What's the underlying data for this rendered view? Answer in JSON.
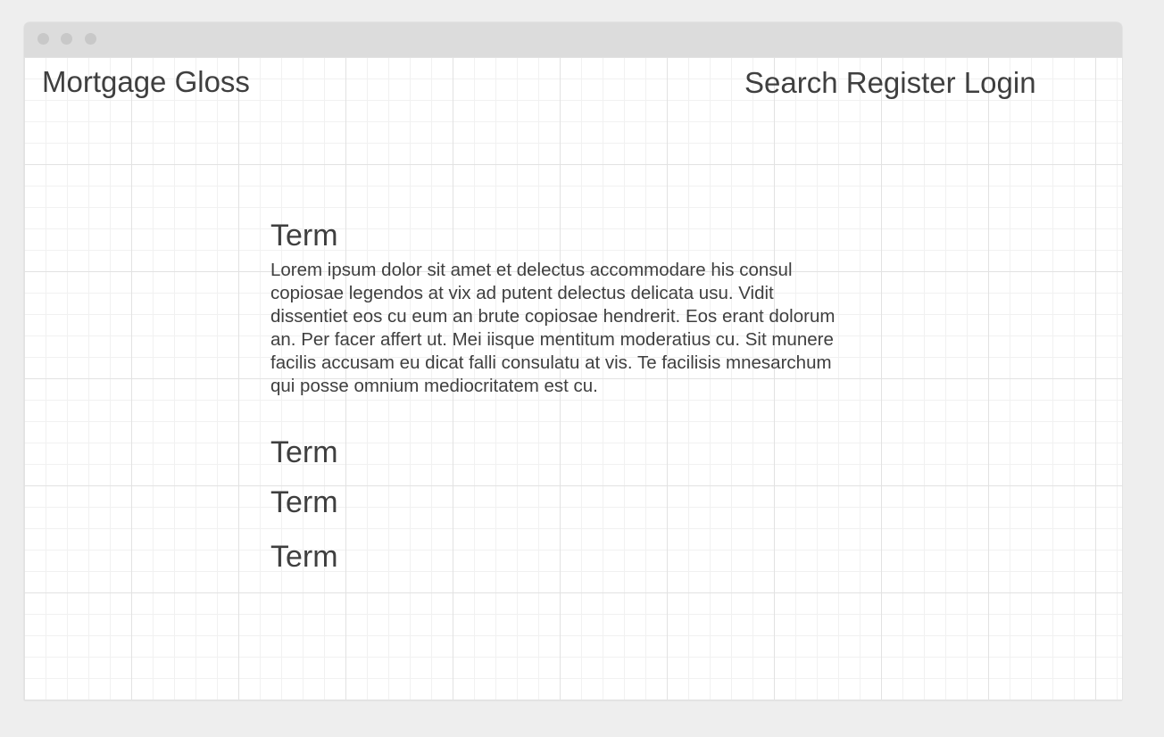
{
  "header": {
    "brand": "Mortgage Gloss",
    "nav": [
      "Search",
      "Register",
      "Login"
    ]
  },
  "glossary": {
    "items": [
      {
        "term": "Term",
        "definition": "Lorem ipsum dolor sit amet et delectus accommodare his consul copiosae legendos at vix ad putent delectus delicata usu. Vidit dissentiet eos cu eum an brute copiosae hendrerit. Eos erant dolorum an. Per facer affert ut. Mei iisque mentitum moderatius cu. Sit munere facilis accusam eu dicat falli consulatu at vis. Te facilisis mnesarchum qui posse omnium mediocritatem est cu."
      },
      {
        "term": "Term"
      },
      {
        "term": "Term"
      },
      {
        "term": "Term"
      }
    ]
  }
}
